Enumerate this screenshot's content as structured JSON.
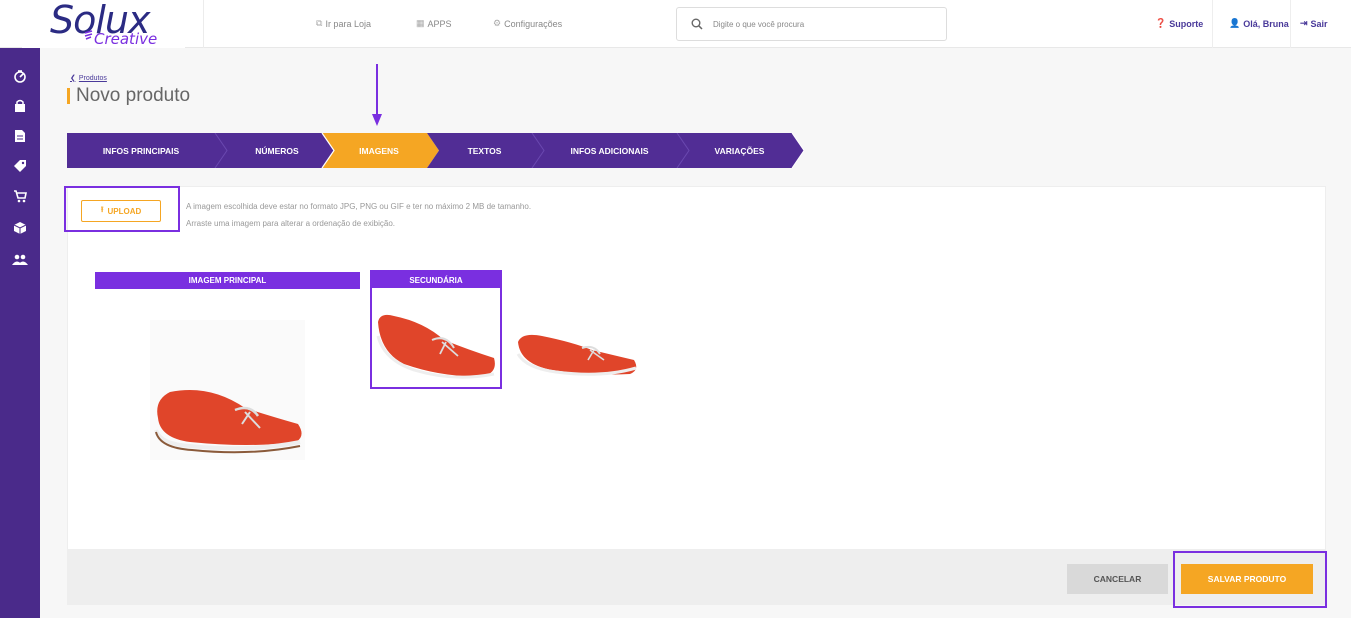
{
  "brand": {
    "logo_main": "Solux",
    "logo_sub": "Creative"
  },
  "header": {
    "nav": [
      {
        "label": "Ir para Loja",
        "icon": "external-link-icon"
      },
      {
        "label": "APPS",
        "icon": "grid-icon"
      },
      {
        "label": "Configurações",
        "icon": "gear-icon"
      }
    ],
    "search_placeholder": "Digite o que você procura",
    "support": "Suporte",
    "user": "Olá, Bruna",
    "logout": "Sair"
  },
  "sidebar": {
    "items": [
      {
        "icon": "dashboard-icon"
      },
      {
        "icon": "orders-icon"
      },
      {
        "icon": "document-icon"
      },
      {
        "icon": "tag-icon"
      },
      {
        "icon": "cart-icon"
      },
      {
        "icon": "box-icon"
      },
      {
        "icon": "users-icon"
      }
    ]
  },
  "page": {
    "breadcrumb": "Produtos",
    "title": "Novo produto"
  },
  "steps": [
    {
      "label": "INFOS PRINCIPAIS",
      "active": false
    },
    {
      "label": "NÚMEROS",
      "active": false
    },
    {
      "label": "IMAGENS",
      "active": true
    },
    {
      "label": "TEXTOS",
      "active": false
    },
    {
      "label": "INFOS ADICIONAIS",
      "active": false
    },
    {
      "label": "VARIAÇÕES",
      "active": false
    }
  ],
  "upload": {
    "button_label": "UPLOAD",
    "help_line1": "A imagem escolhida deve estar no formato JPG, PNG ou GIF e ter no máximo 2 MB de tamanho.",
    "help_line2": "Arraste uma imagem para alterar a ordenação de exibição."
  },
  "images": {
    "main_label": "IMAGEM PRINCIPAL",
    "secondary_label": "SECUNDÁRIA"
  },
  "footer": {
    "cancel_label": "CANCELAR",
    "save_label": "SALVAR PRODUTO"
  },
  "colors": {
    "purple_dark": "#4a2a8a",
    "purple_step": "#512d95",
    "purple_accent": "#7a2fe0",
    "orange": "#f5a623",
    "shoe": "#e0452a"
  }
}
